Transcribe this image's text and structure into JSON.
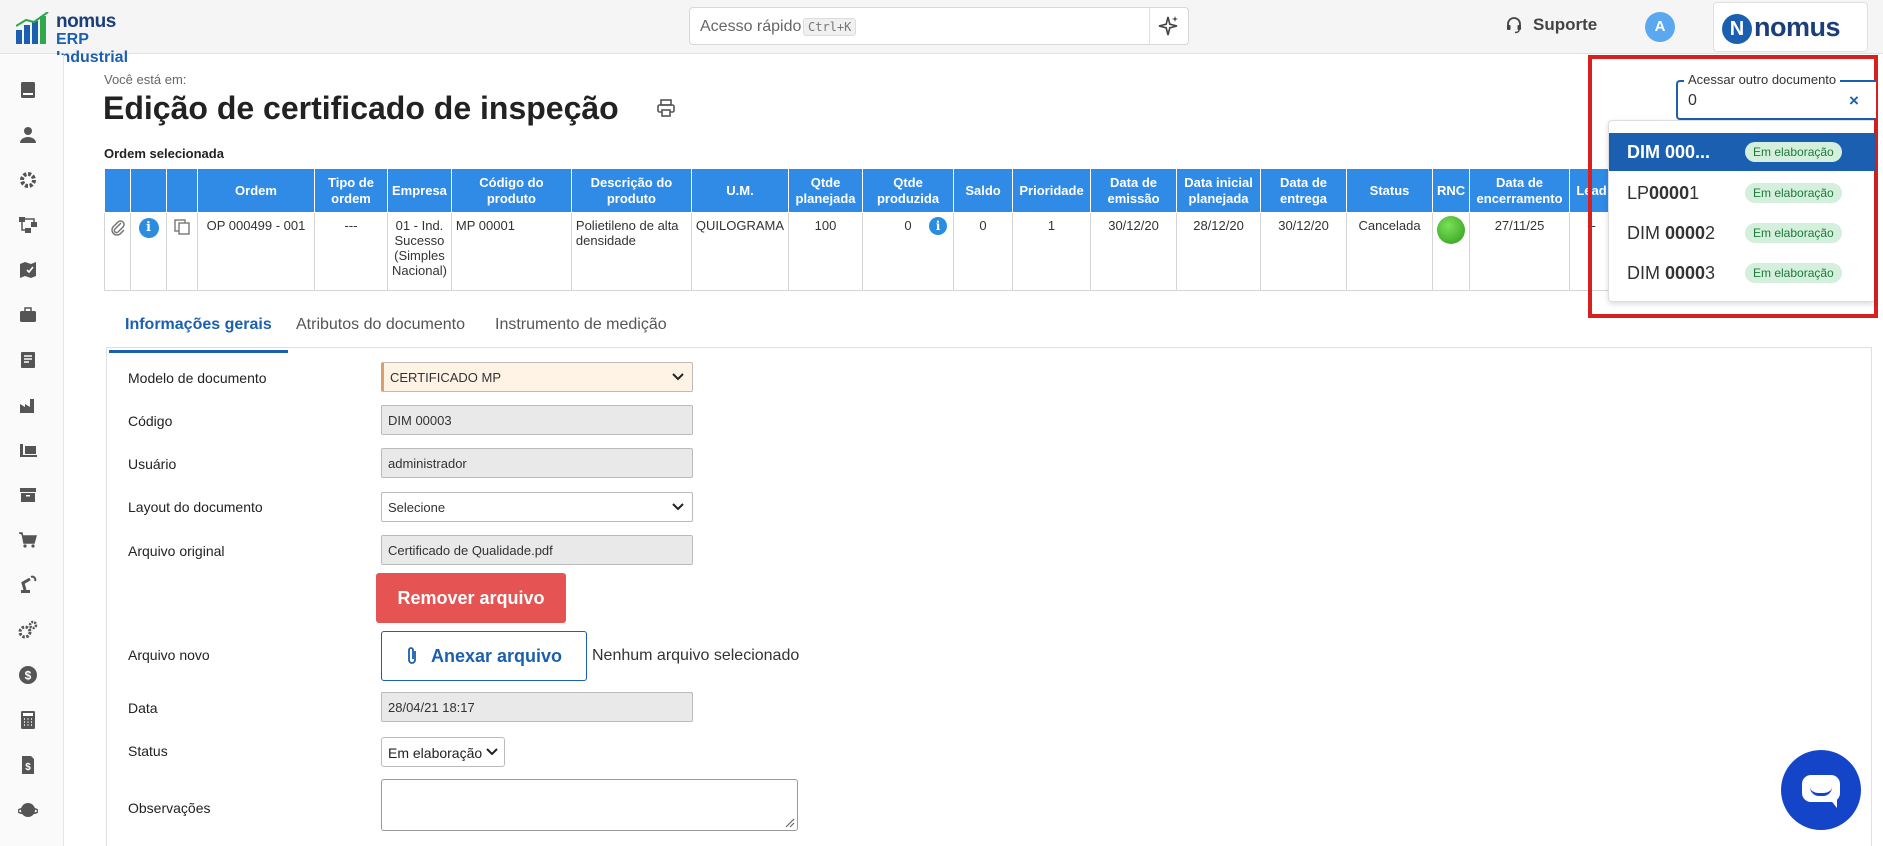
{
  "topbar": {
    "logo_line1": "nomus",
    "logo_line2": "ERP Industrial",
    "search_placeholder": "Acesso rápido",
    "search_shortcut": "Ctrl+K",
    "support_label": "Suporte",
    "avatar_initial": "A",
    "brand_name": "nomus",
    "brand_letter": "N"
  },
  "sidebar_icons": [
    "book-icon",
    "user-icon",
    "gear-icon",
    "flow-icon",
    "map-icon",
    "briefcase-icon",
    "document-icon",
    "factory-icon",
    "forklift-icon",
    "archive-icon",
    "cart-icon",
    "robot-arm-icon",
    "settings-cluster-icon",
    "dollar-icon",
    "calculator-icon",
    "invoice-icon",
    "planet-icon"
  ],
  "page": {
    "breadcrumb": "Você está em:",
    "title": "Edição de certificado de inspeção",
    "selected_order_label": "Ordem selecionada"
  },
  "order_table": {
    "headers": [
      "",
      "",
      "",
      "Ordem",
      "Tipo de ordem",
      "Empresa",
      "Código do produto",
      "Descrição do produto",
      "U.M.",
      "Qtde planejada",
      "Qtde produzida",
      "Saldo",
      "Prioridade",
      "Data de emissão",
      "Data inicial planejada",
      "Data de entrega",
      "Status",
      "RNC",
      "Data de encerramento",
      "Lead"
    ],
    "row": {
      "ordem": "OP 000499 - 001",
      "tipo": "---",
      "empresa": "01 - Ind. Sucesso (Simples Nacional)",
      "codigo": "MP 00001",
      "descricao": "Polietileno de alta densidade",
      "um": "QUILOGRAMA",
      "qtde_planejada": "100",
      "qtde_produzida": "0",
      "saldo": "0",
      "prioridade": "1",
      "data_emissao": "30/12/20",
      "data_inicial": "28/12/20",
      "data_entrega": "30/12/20",
      "status": "Cancelada",
      "data_encerramento": "27/11/25",
      "lead": "--"
    }
  },
  "tabs": [
    "Informações gerais",
    "Atributos do documento",
    "Instrumento de medição"
  ],
  "form": {
    "modelo_label": "Modelo de documento",
    "modelo_value": "CERTIFICADO MP",
    "codigo_label": "Código",
    "codigo_value": "DIM 00003",
    "usuario_label": "Usuário",
    "usuario_value": "administrador",
    "layout_label": "Layout do documento",
    "layout_value": "Selecione",
    "arquivo_original_label": "Arquivo original",
    "arquivo_original_value": "Certificado de Qualidade.pdf",
    "remover_label": "Remover arquivo",
    "arquivo_novo_label": "Arquivo novo",
    "anexar_label": "Anexar arquivo",
    "nenhum_arquivo": "Nenhum arquivo selecionado",
    "data_label": "Data",
    "data_value": "28/04/21 18:17",
    "status_label": "Status",
    "status_value": "Em elaboração",
    "observacoes_label": "Observações"
  },
  "access_doc": {
    "label": "Acessar outro documento",
    "value": "0",
    "clear": "×",
    "items": [
      {
        "prefix": "DIM 000...",
        "bold": "",
        "suffix": "",
        "badge": "Em elaboração"
      },
      {
        "prefix": "LP",
        "bold": "0000",
        "suffix": "1",
        "badge": "Em elaboração"
      },
      {
        "prefix": "DIM ",
        "bold": "0000",
        "suffix": "2",
        "badge": "Em elaboração"
      },
      {
        "prefix": "DIM ",
        "bold": "0000",
        "suffix": "3",
        "badge": "Em elaboração"
      }
    ]
  },
  "colors": {
    "primary": "#1b5fb0",
    "table_header": "#2f8be6",
    "danger": "#e55353",
    "highlight_box": "#d92020",
    "badge_bg": "#d4f0dc",
    "chat": "#1444c8"
  }
}
